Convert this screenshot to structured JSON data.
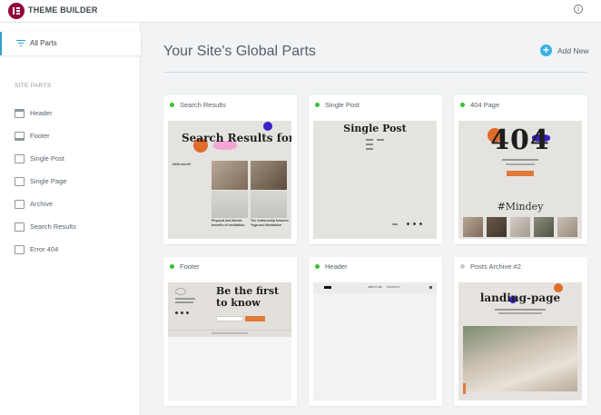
{
  "app": {
    "title": "THEME BUILDER"
  },
  "sidebar": {
    "all_parts": "All Parts",
    "section_header": "SITE PARTS",
    "items": [
      {
        "label": "Header",
        "icon": "header-icon"
      },
      {
        "label": "Footer",
        "icon": "footer-icon"
      },
      {
        "label": "Single Post",
        "icon": "single-post-icon"
      },
      {
        "label": "Single Page",
        "icon": "single-page-icon"
      },
      {
        "label": "Archive",
        "icon": "archive-icon"
      },
      {
        "label": "Search Results",
        "icon": "search-results-icon"
      },
      {
        "label": "Error 404",
        "icon": "error-404-icon"
      }
    ]
  },
  "main": {
    "title": "Your Site's Global Parts",
    "add_new": "Add New"
  },
  "colors": {
    "active": "#37c02e",
    "inactive": "#c4c7ca",
    "accent": "#39b0e5",
    "brand": "#92003b"
  },
  "cards": [
    {
      "title": "Search Results",
      "active": true,
      "preview": {
        "heading": "Search Results for:",
        "hello": "Hello world!",
        "post1": "Physical and Mental benefits of meditation",
        "post2": "The relationship between Yoga and Meditation"
      }
    },
    {
      "title": "Single Post",
      "active": true,
      "preview": {
        "heading": "Single Post"
      }
    },
    {
      "title": "404 Page",
      "active": true,
      "preview": {
        "code": "404",
        "handle": "#Mindey"
      }
    },
    {
      "title": "Footer",
      "active": true,
      "preview": {
        "heading": "Be the first to know"
      }
    },
    {
      "title": "Header",
      "active": true,
      "preview": {
        "nav1": "ABOUT ME",
        "nav2": "CONTACT"
      }
    },
    {
      "title": "Posts Archive #2",
      "active": false,
      "preview": {
        "heading": "landing-page"
      }
    }
  ]
}
